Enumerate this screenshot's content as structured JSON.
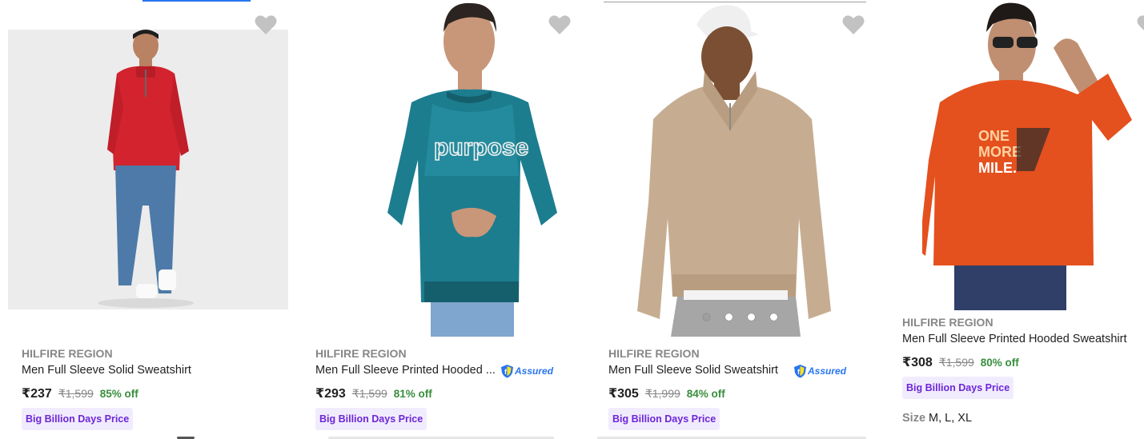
{
  "products": [
    {
      "brand": "HILFIRE REGION",
      "title": "Men Full Sleeve Solid Sweatshirt",
      "price": "₹237",
      "mrp": "₹1,599",
      "discount": "85% off",
      "deal": "Big Billion Days Price",
      "assured": false,
      "sweatshirt_color": "#d2232f"
    },
    {
      "brand": "HILFIRE REGION",
      "title": "Men Full Sleeve Printed Hooded ...",
      "price": "₹293",
      "mrp": "₹1,599",
      "discount": "81% off",
      "deal": "Big Billion Days Price",
      "assured": true,
      "assured_label": "Assured",
      "sweatshirt_color": "#1c7d8f",
      "print_text": "purpose"
    },
    {
      "brand": "HILFIRE REGION",
      "title": "Men Full Sleeve Solid Sweatshirt",
      "price": "₹305",
      "mrp": "₹1,999",
      "discount": "84% off",
      "deal": "Big Billion Days Price",
      "assured": true,
      "assured_label": "Assured",
      "sweatshirt_color": "#c6ad91",
      "image_dots": 4,
      "active_dot": 0
    },
    {
      "brand": "HILFIRE REGION",
      "title": "Men Full Sleeve Printed Hooded Sweatshirt",
      "price": "₹308",
      "mrp": "₹1,599",
      "discount": "80% off",
      "deal": "Big Billion Days Price",
      "assured": false,
      "size_label": "Size",
      "sizes": "M, L, XL",
      "sweatshirt_color": "#e4501e",
      "print_text": "ONE MORE MILE."
    }
  ],
  "icons": {
    "wishlist": "heart-icon",
    "assured": "flipkart-assured-shield-icon"
  },
  "colors": {
    "price_off": "#388e3c",
    "deal_text": "#6d26d8",
    "deal_bg": "#f1ecfd",
    "assured_blue": "#2874f0",
    "brand_grey": "#878787"
  }
}
